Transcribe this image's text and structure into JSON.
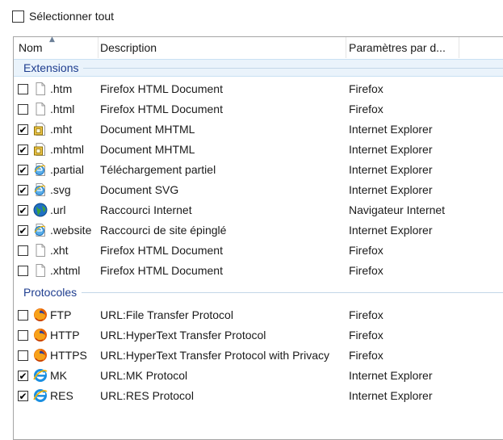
{
  "select_all": {
    "label": "Sélectionner tout",
    "checked": false
  },
  "columns": {
    "name": "Nom",
    "description": "Description",
    "default": "Paramètres par d..."
  },
  "groups": [
    {
      "label": "Extensions",
      "selected": true,
      "rows": [
        {
          "name": ".htm",
          "description": "Firefox HTML Document",
          "default": "Firefox",
          "checked": false,
          "icon": "blank-doc"
        },
        {
          "name": ".html",
          "description": "Firefox HTML Document",
          "default": "Firefox",
          "checked": false,
          "icon": "blank-doc"
        },
        {
          "name": ".mht",
          "description": "Document MHTML",
          "default": "Internet Explorer",
          "checked": true,
          "icon": "mht-doc"
        },
        {
          "name": ".mhtml",
          "description": "Document MHTML",
          "default": "Internet Explorer",
          "checked": true,
          "icon": "mht-doc"
        },
        {
          "name": ".partial",
          "description": "Téléchargement partiel",
          "default": "Internet Explorer",
          "checked": true,
          "icon": "ie-doc"
        },
        {
          "name": ".svg",
          "description": "Document SVG",
          "default": "Internet Explorer",
          "checked": true,
          "icon": "ie-doc"
        },
        {
          "name": ".url",
          "description": "Raccourci Internet",
          "default": "Navigateur Internet",
          "checked": true,
          "icon": "globe"
        },
        {
          "name": ".website",
          "description": "Raccourci de site épinglé",
          "default": "Internet Explorer",
          "checked": true,
          "icon": "ie-doc"
        },
        {
          "name": ".xht",
          "description": "Firefox HTML Document",
          "default": "Firefox",
          "checked": false,
          "icon": "blank-doc"
        },
        {
          "name": ".xhtml",
          "description": "Firefox HTML Document",
          "default": "Firefox",
          "checked": false,
          "icon": "blank-doc"
        }
      ]
    },
    {
      "label": "Protocoles",
      "selected": false,
      "rows": [
        {
          "name": "FTP",
          "description": "URL:File Transfer Protocol",
          "default": "Firefox",
          "checked": false,
          "icon": "firefox"
        },
        {
          "name": "HTTP",
          "description": "URL:HyperText Transfer Protocol",
          "default": "Firefox",
          "checked": false,
          "icon": "firefox"
        },
        {
          "name": "HTTPS",
          "description": "URL:HyperText Transfer Protocol with Privacy",
          "default": "Firefox",
          "checked": false,
          "icon": "firefox"
        },
        {
          "name": "MK",
          "description": "URL:MK Protocol",
          "default": "Internet Explorer",
          "checked": true,
          "icon": "ie"
        },
        {
          "name": "RES",
          "description": "URL:RES Protocol",
          "default": "Internet Explorer",
          "checked": true,
          "icon": "ie"
        }
      ]
    }
  ],
  "colors": {
    "group_text": "#1e3d8f",
    "selected_band": "#eaf3fb",
    "border": "#a5a5a5"
  }
}
